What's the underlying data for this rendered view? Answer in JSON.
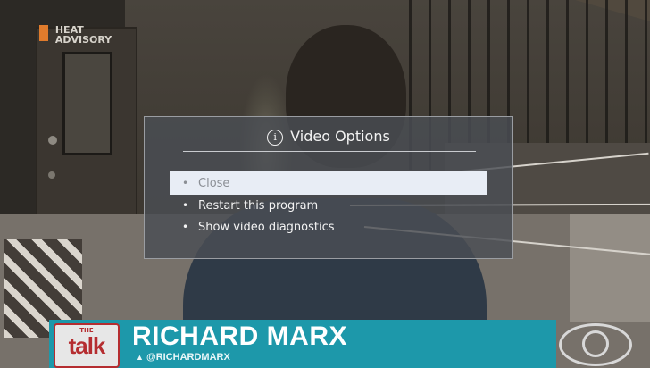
{
  "background": {
    "heat_advisory": "HEAT\nADVISORY"
  },
  "dialog": {
    "title": "Video Options",
    "icon": "info-circle-icon",
    "items": [
      {
        "label": "Close",
        "selected": true
      },
      {
        "label": "Restart this program",
        "selected": false
      },
      {
        "label": "Show video diagnostics",
        "selected": false
      }
    ]
  },
  "lower_third": {
    "show_small": "THE",
    "show_logo": "talk",
    "guest_name": "RICHARD MARX",
    "guest_handle": "@RICHARDMARX",
    "network_logo": "cbs-eye-icon"
  },
  "colors": {
    "lower_third": "#1d98aa",
    "selected_item_bg": "#e8edf5",
    "dialog_bg": "rgba(74,78,84,0.82)"
  }
}
